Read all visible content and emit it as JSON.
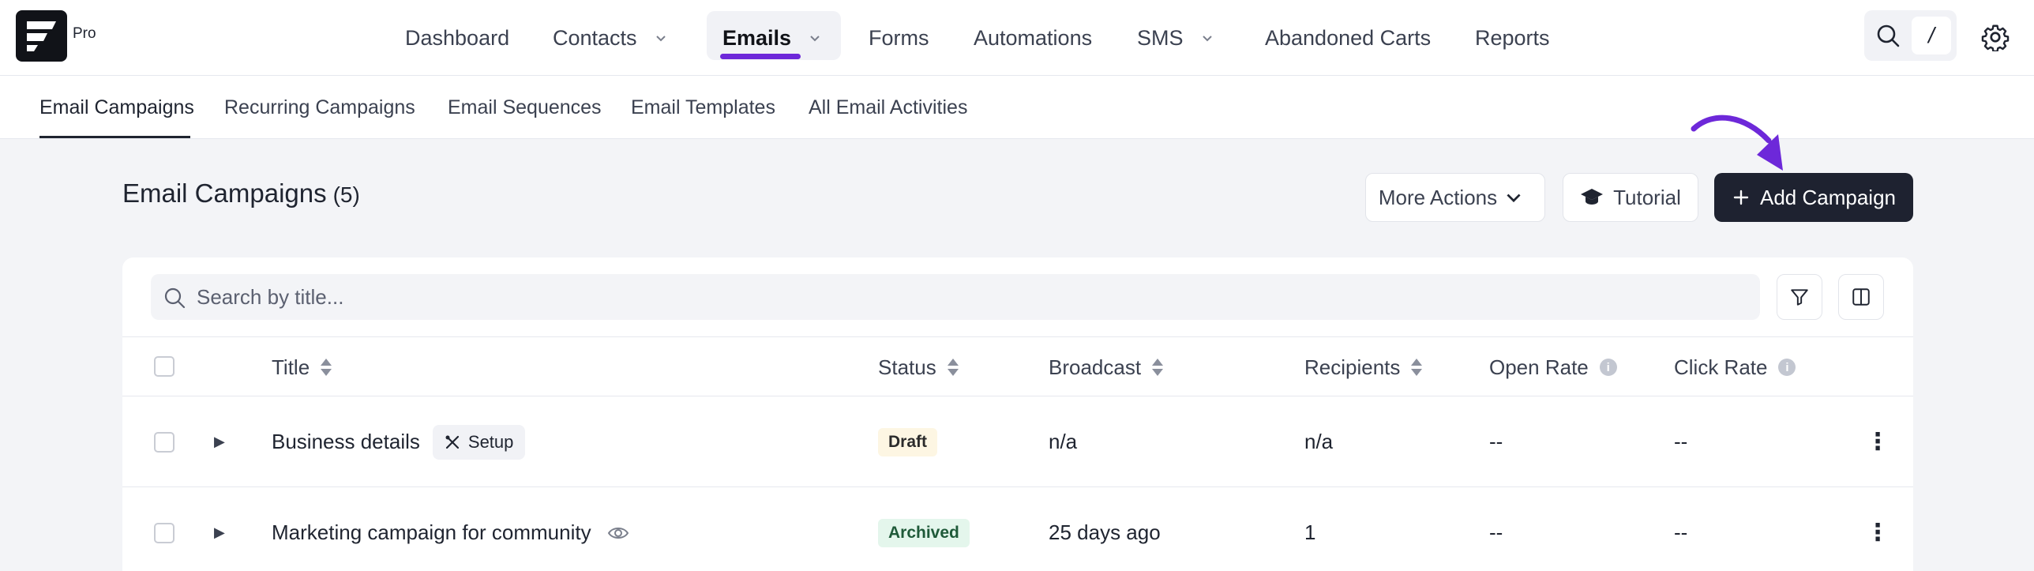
{
  "brand": {
    "badge": "Pro"
  },
  "topnav": {
    "items": [
      {
        "label": "Dashboard"
      },
      {
        "label": "Contacts"
      },
      {
        "label": "Emails"
      },
      {
        "label": "Forms"
      },
      {
        "label": "Automations"
      },
      {
        "label": "SMS"
      },
      {
        "label": "Abandoned Carts"
      },
      {
        "label": "Reports"
      }
    ],
    "search_shortcut": "/"
  },
  "subnav": {
    "items": [
      {
        "label": "Email Campaigns"
      },
      {
        "label": "Recurring Campaigns"
      },
      {
        "label": "Email Sequences"
      },
      {
        "label": "Email Templates"
      },
      {
        "label": "All Email Activities"
      }
    ]
  },
  "page": {
    "title": "Email Campaigns",
    "count": "(5)",
    "more_actions": "More Actions",
    "tutorial": "Tutorial",
    "add_campaign": "Add Campaign"
  },
  "search": {
    "placeholder": "Search by title..."
  },
  "table": {
    "columns": [
      {
        "label": "Title"
      },
      {
        "label": "Status"
      },
      {
        "label": "Broadcast"
      },
      {
        "label": "Recipients"
      },
      {
        "label": "Open Rate"
      },
      {
        "label": "Click Rate"
      }
    ],
    "rows": [
      {
        "title": "Business details",
        "tag": "Setup",
        "status": "Draft",
        "broadcast": "n/a",
        "recipients": "n/a",
        "open_rate": "--",
        "click_rate": "--"
      },
      {
        "title": "Marketing campaign for community",
        "status": "Archived",
        "broadcast": "25 days ago",
        "recipients": "1",
        "open_rate": "--",
        "click_rate": "--"
      }
    ]
  },
  "colors": {
    "accent": "#6d28d9",
    "dark_button": "#1e2230",
    "archived_bg": "#e4f6ec",
    "draft_bg": "#fdf6e3"
  }
}
